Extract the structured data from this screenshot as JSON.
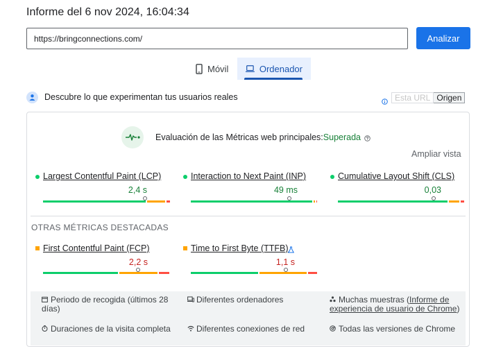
{
  "report": {
    "title": "Informe del 6 nov 2024, 16:04:34"
  },
  "url_input": {
    "value": "https://bringconnections.com/"
  },
  "analyze_button": "Analizar",
  "tabs": [
    {
      "label": "Móvil",
      "icon": "phone-icon",
      "selected": false
    },
    {
      "label": "Ordenador",
      "icon": "laptop-icon",
      "selected": true
    }
  ],
  "crux": {
    "title": "Descubre lo que experimentan tus usuarios reales",
    "toggle": {
      "url": "Esta URL",
      "origin": "Origen",
      "selected": "origin"
    }
  },
  "assessment": {
    "label": "Evaluación de las Métricas web principales:",
    "status": "Superada",
    "expand": "Ampliar vista"
  },
  "core_metrics": [
    {
      "name": "Largest Contentful Paint (LCP)",
      "value": "2,4 s",
      "rating": "good",
      "distribution": [
        0.81,
        0.15,
        0.04
      ],
      "marker": 0.795
    },
    {
      "name": "Interaction to Next Paint (INP)",
      "value": "49 ms",
      "rating": "good",
      "distribution": [
        0.97,
        0.02,
        0.01
      ],
      "marker": 0.77
    },
    {
      "name": "Cumulative Layout Shift (CLS)",
      "value": "0,03",
      "rating": "good",
      "distribution": [
        0.87,
        0.09,
        0.04
      ],
      "marker": 0.75
    }
  ],
  "other_heading": "OTRAS MÉTRICAS DESTACADAS",
  "other_metrics": [
    {
      "name": "First Contentful Paint (FCP)",
      "value": "2,2 s",
      "rating": "average",
      "distribution": [
        0.6,
        0.31,
        0.09
      ],
      "marker": 0.745
    },
    {
      "name": "Time to First Byte (TTFB)",
      "value": "1,1 s",
      "rating": "average",
      "distribution": [
        0.54,
        0.38,
        0.08
      ],
      "marker": 0.745,
      "experimental_icon": "flask-icon"
    }
  ],
  "footer": {
    "period": "Periodo de recogida (últimos 28 días)",
    "devices": "Diferentes ordenadores",
    "samples_prefix": "Muchas muestras (",
    "samples_link": "Informe de experiencia de usuario de Chrome",
    "samples_suffix": ")",
    "durations": "Duraciones de la visita completa",
    "connections": "Diferentes conexiones de red",
    "versions": "Todas las versiones de Chrome"
  },
  "colors": {
    "good": "#0cce6b",
    "average": "#ffa400",
    "poor": "#ff4e42",
    "accent": "#1a73e8",
    "pass": "#188038",
    "value_good": "#188038",
    "value_average": "#c5221f"
  }
}
